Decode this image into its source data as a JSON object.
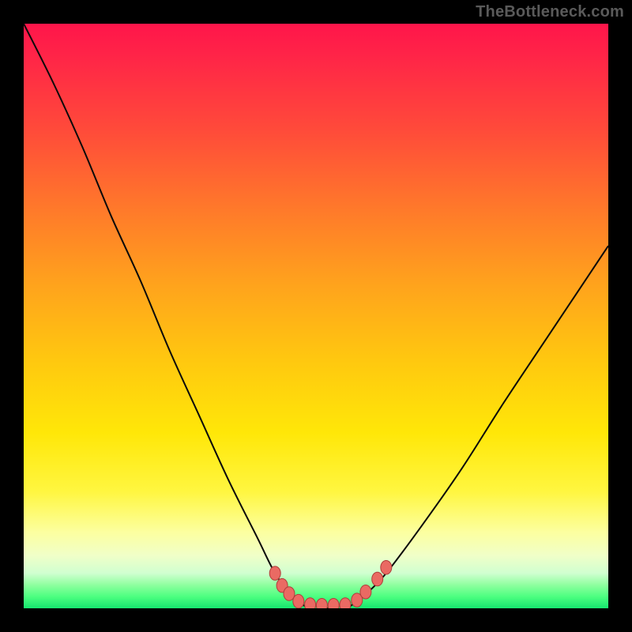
{
  "watermark": "TheBottleneck.com",
  "chart_data": {
    "type": "line",
    "title": "",
    "xlabel": "",
    "ylabel": "",
    "xlim": [
      0,
      100
    ],
    "ylim": [
      0,
      100
    ],
    "series": [
      {
        "name": "bottleneck-curve",
        "x": [
          0,
          5,
          10,
          15,
          20,
          25,
          30,
          35,
          40,
          43,
          46,
          49,
          52,
          55,
          58,
          62,
          68,
          75,
          82,
          90,
          100
        ],
        "values": [
          100,
          90,
          79,
          67,
          56,
          44,
          33,
          22,
          12,
          6,
          2,
          0,
          0,
          0,
          2,
          6,
          14,
          24,
          35,
          47,
          62
        ]
      }
    ],
    "markers": [
      {
        "name": "left-upper-marker",
        "x": 43.0,
        "y": 6.0
      },
      {
        "name": "left-mid-marker-1",
        "x": 44.2,
        "y": 3.9
      },
      {
        "name": "left-mid-marker-2",
        "x": 45.4,
        "y": 2.5
      },
      {
        "name": "flat-marker-1",
        "x": 47.0,
        "y": 1.2
      },
      {
        "name": "flat-marker-2",
        "x": 49.0,
        "y": 0.6
      },
      {
        "name": "flat-marker-3",
        "x": 51.0,
        "y": 0.5
      },
      {
        "name": "flat-marker-4",
        "x": 53.0,
        "y": 0.5
      },
      {
        "name": "flat-marker-5",
        "x": 55.0,
        "y": 0.6
      },
      {
        "name": "right-mid-marker-1",
        "x": 57.0,
        "y": 1.4
      },
      {
        "name": "right-mid-marker-2",
        "x": 58.5,
        "y": 2.8
      },
      {
        "name": "right-upper-marker",
        "x": 60.5,
        "y": 5.0
      },
      {
        "name": "right-top-marker",
        "x": 62.0,
        "y": 7.0
      }
    ],
    "marker_style": {
      "fill": "#ea6a63",
      "stroke": "#b03d3a",
      "r": 7
    },
    "curve_style": {
      "stroke": "#0a0a0a",
      "width": 2
    }
  }
}
